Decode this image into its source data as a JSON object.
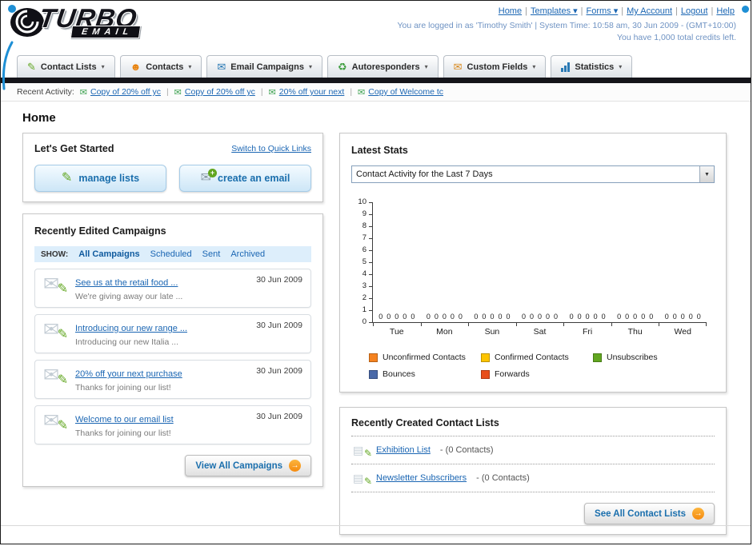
{
  "header": {
    "logo": {
      "top": "TURBO",
      "bottom": "EMAIL"
    },
    "nav": [
      {
        "label": "Home",
        "dropdown": false
      },
      {
        "label": "Templates",
        "dropdown": true
      },
      {
        "label": "Forms",
        "dropdown": true
      },
      {
        "label": "My Account",
        "dropdown": false
      },
      {
        "label": "Logout",
        "dropdown": false
      },
      {
        "label": "Help",
        "dropdown": false
      }
    ],
    "session_line": "You are logged in as 'Timothy Smith' | System Time: 10:58 am, 30 Jun 2009 - (GMT+10:00)",
    "credits_line": "You have 1,000 total credits left."
  },
  "nav_tabs": [
    {
      "label": "Contact Lists",
      "icon": "list-pencil-icon"
    },
    {
      "label": "Contacts",
      "icon": "contacts-icon"
    },
    {
      "label": "Email Campaigns",
      "icon": "envelope-icon"
    },
    {
      "label": "Autoresponders",
      "icon": "autoresponder-icon"
    },
    {
      "label": "Custom Fields",
      "icon": "custom-field-icon"
    },
    {
      "label": "Statistics",
      "icon": "bar-chart-icon"
    }
  ],
  "recent_activity": {
    "label": "Recent Activity:",
    "items": [
      {
        "label": "Copy of 20% off yc"
      },
      {
        "label": "Copy of 20% off yc"
      },
      {
        "label": "20% off your next"
      },
      {
        "label": "Copy of Welcome tc"
      }
    ]
  },
  "page_title": "Home",
  "get_started": {
    "title": "Let's Get Started",
    "switch_link": "Switch to Quick Links",
    "manage_lists_button": "manage lists",
    "create_email_button": "create an email"
  },
  "campaigns": {
    "title": "Recently Edited Campaigns",
    "show_label": "SHOW:",
    "filters": [
      "All Campaigns",
      "Scheduled",
      "Sent",
      "Archived"
    ],
    "active_filter": "All Campaigns",
    "items": [
      {
        "title": "See us at the retail food ...",
        "subtitle": "We're giving away our late ...",
        "date": "30 Jun 2009"
      },
      {
        "title": "Introducing our new range ...",
        "subtitle": "Introducing our new Italia ...",
        "date": "30 Jun 2009"
      },
      {
        "title": "20% off your next purchase",
        "subtitle": "Thanks for joining our list!",
        "date": "30 Jun 2009"
      },
      {
        "title": "Welcome to our email list",
        "subtitle": "Thanks for joining our list!",
        "date": "30 Jun 2009"
      }
    ],
    "view_all_button": "View All Campaigns"
  },
  "latest_stats": {
    "title": "Latest Stats",
    "dropdown_value": "Contact Activity for the Last 7 Days"
  },
  "chart_data": {
    "type": "bar",
    "title": "Contact Activity for the Last 7 Days",
    "xlabel": "",
    "ylabel": "",
    "categories": [
      "Tue",
      "Mon",
      "Sun",
      "Sat",
      "Fri",
      "Thu",
      "Wed"
    ],
    "series": [
      {
        "name": "Unconfirmed Contacts",
        "color": "#f5821f",
        "values": [
          0,
          0,
          0,
          0,
          0,
          0,
          0
        ]
      },
      {
        "name": "Confirmed Contacts",
        "color": "#fdc400",
        "values": [
          0,
          0,
          0,
          0,
          0,
          0,
          0
        ]
      },
      {
        "name": "Unsubscribes",
        "color": "#61a620",
        "values": [
          0,
          0,
          0,
          0,
          0,
          0,
          0
        ]
      },
      {
        "name": "Bounces",
        "color": "#4a69a8",
        "values": [
          0,
          0,
          0,
          0,
          0,
          0,
          0
        ]
      },
      {
        "name": "Forwards",
        "color": "#e84e1b",
        "values": [
          0,
          0,
          0,
          0,
          0,
          0,
          0
        ]
      }
    ],
    "ylim": [
      0,
      10
    ],
    "ytick_step": 1,
    "grid": false,
    "legend_position": "bottom",
    "data_labels_shown": true
  },
  "contact_lists_panel": {
    "title": "Recently Created Contact Lists",
    "items": [
      {
        "name": "Exhibition List",
        "suffix": "- (0 Contacts)"
      },
      {
        "name": "Newsletter Subscribers",
        "suffix": "- (0 Contacts)"
      }
    ],
    "see_all_button": "See All Contact Lists"
  }
}
